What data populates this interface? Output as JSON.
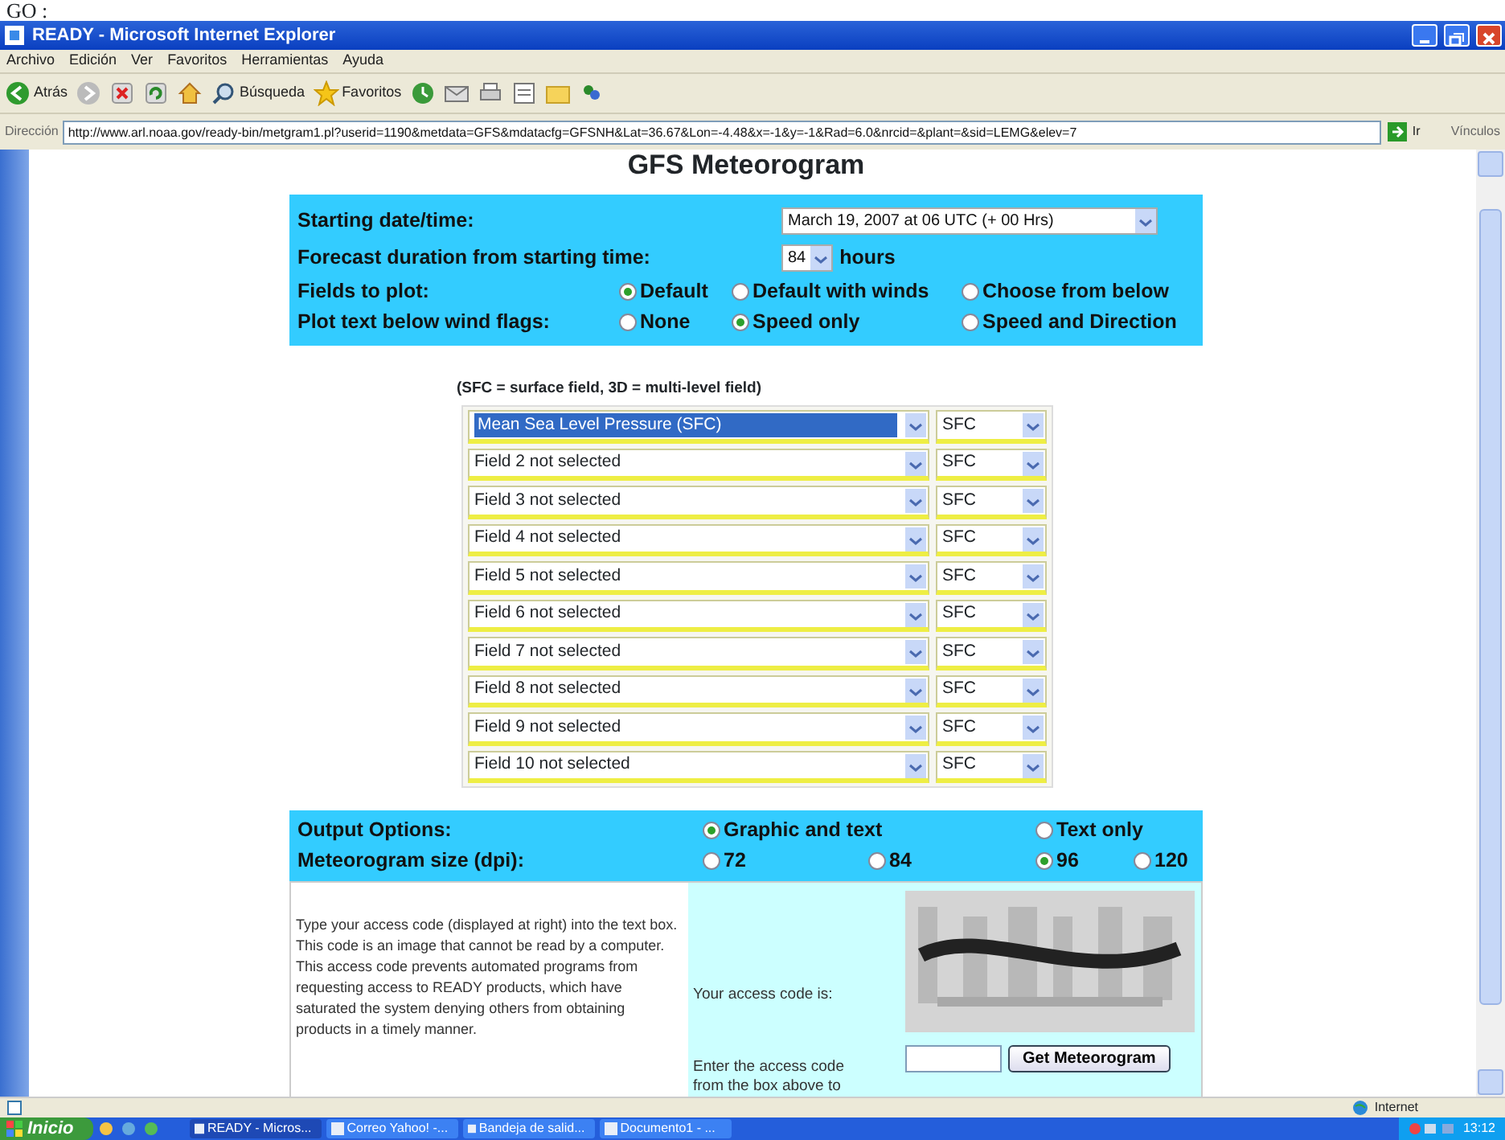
{
  "top_fragment": "GO :",
  "window": {
    "title": "READY - Microsoft Internet Explorer"
  },
  "menu": [
    "Archivo",
    "Edición",
    "Ver",
    "Favoritos",
    "Herramientas",
    "Ayuda"
  ],
  "toolbar": [
    {
      "kind": "back",
      "label": "Atrás"
    },
    {
      "kind": "forward"
    },
    {
      "kind": "stop"
    },
    {
      "kind": "refresh"
    },
    {
      "kind": "home"
    },
    {
      "kind": "search",
      "label": "Búsqueda"
    },
    {
      "kind": "favorites",
      "label": "Favoritos"
    },
    {
      "kind": "history"
    },
    {
      "kind": "mail"
    },
    {
      "kind": "print"
    },
    {
      "kind": "edit"
    },
    {
      "kind": "notes"
    },
    {
      "kind": "messenger"
    }
  ],
  "address_bar": {
    "label": "Dirección",
    "url": "http://www.arl.noaa.gov/ready-bin/metgram1.pl?userid=1190&metdata=GFS&mdatacfg=GFSNH&Lat=36.67&Lon=-4.48&x=-1&y=-1&Rad=6.0&nrcid=&plant=&sid=LEMG&elev=7",
    "go": "Ir",
    "links": "Vínculos"
  },
  "page": {
    "title": "GFS Meteorogram",
    "start": {
      "label": "Starting date/time:",
      "value": "March 19, 2007 at 06 UTC (+ 00 Hrs)"
    },
    "duration": {
      "label": "Forecast duration from starting time:",
      "value": "84",
      "unit": "hours"
    },
    "radio_rows": [
      {
        "label": "Fields to plot:",
        "options": [
          {
            "label": "Default",
            "selected": true
          },
          {
            "label": "Default with winds",
            "selected": false
          },
          {
            "label": "Choose from below",
            "selected": false
          }
        ]
      },
      {
        "label": "Plot text below wind flags:",
        "options": [
          {
            "label": "None",
            "selected": false
          },
          {
            "label": "Speed only",
            "selected": true
          },
          {
            "label": "Speed and Direction",
            "selected": false
          }
        ]
      }
    ],
    "note": "(SFC = surface field, 3D = multi-level field)",
    "fields": [
      {
        "field": "Mean Sea Level Pressure (SFC)",
        "level": "SFC",
        "highlighted": true
      },
      {
        "field": "Field 2 not selected",
        "level": "SFC",
        "highlighted": false
      },
      {
        "field": "Field 3 not selected",
        "level": "SFC",
        "highlighted": false
      },
      {
        "field": "Field 4 not selected",
        "level": "SFC",
        "highlighted": false
      },
      {
        "field": "Field 5 not selected",
        "level": "SFC",
        "highlighted": false
      },
      {
        "field": "Field 6 not selected",
        "level": "SFC",
        "highlighted": false
      },
      {
        "field": "Field 7 not selected",
        "level": "SFC",
        "highlighted": false
      },
      {
        "field": "Field 8 not selected",
        "level": "SFC",
        "highlighted": false
      },
      {
        "field": "Field 9 not selected",
        "level": "SFC",
        "highlighted": false
      },
      {
        "field": "Field 10 not selected",
        "level": "SFC",
        "highlighted": false
      }
    ],
    "output_rows": [
      {
        "label": "Output Options:",
        "options": [
          {
            "label": "Graphic and text",
            "selected": true
          },
          {
            "label": "Text only",
            "selected": false
          }
        ]
      },
      {
        "label": "Meteorogram size (dpi):",
        "options": [
          {
            "label": "72",
            "selected": false
          },
          {
            "label": "84",
            "selected": false
          },
          {
            "label": "96",
            "selected": true
          },
          {
            "label": "120",
            "selected": false
          }
        ]
      }
    ],
    "access": {
      "explanation": "Type your access code (displayed at right) into the text box. This code is an image that cannot be read by a computer. This access code prevents automated programs from requesting access to READY products, which have saturated the system denying others from obtaining products in a timely manner.",
      "code_label": "Your access code is:",
      "enter_label": "Enter the access code from the box above to",
      "button": "Get Meteorogram"
    }
  },
  "status_bar": {
    "zone": "Internet"
  },
  "taskbar": {
    "start": "Inicio",
    "tasks": [
      {
        "label": "READY - Micros...",
        "selected": true
      },
      {
        "label": "Correo Yahoo! -...",
        "selected": false
      },
      {
        "label": "Bandeja de salid...",
        "selected": false
      },
      {
        "label": "Documento1 - ...",
        "selected": false
      }
    ],
    "clock": "13:12"
  }
}
